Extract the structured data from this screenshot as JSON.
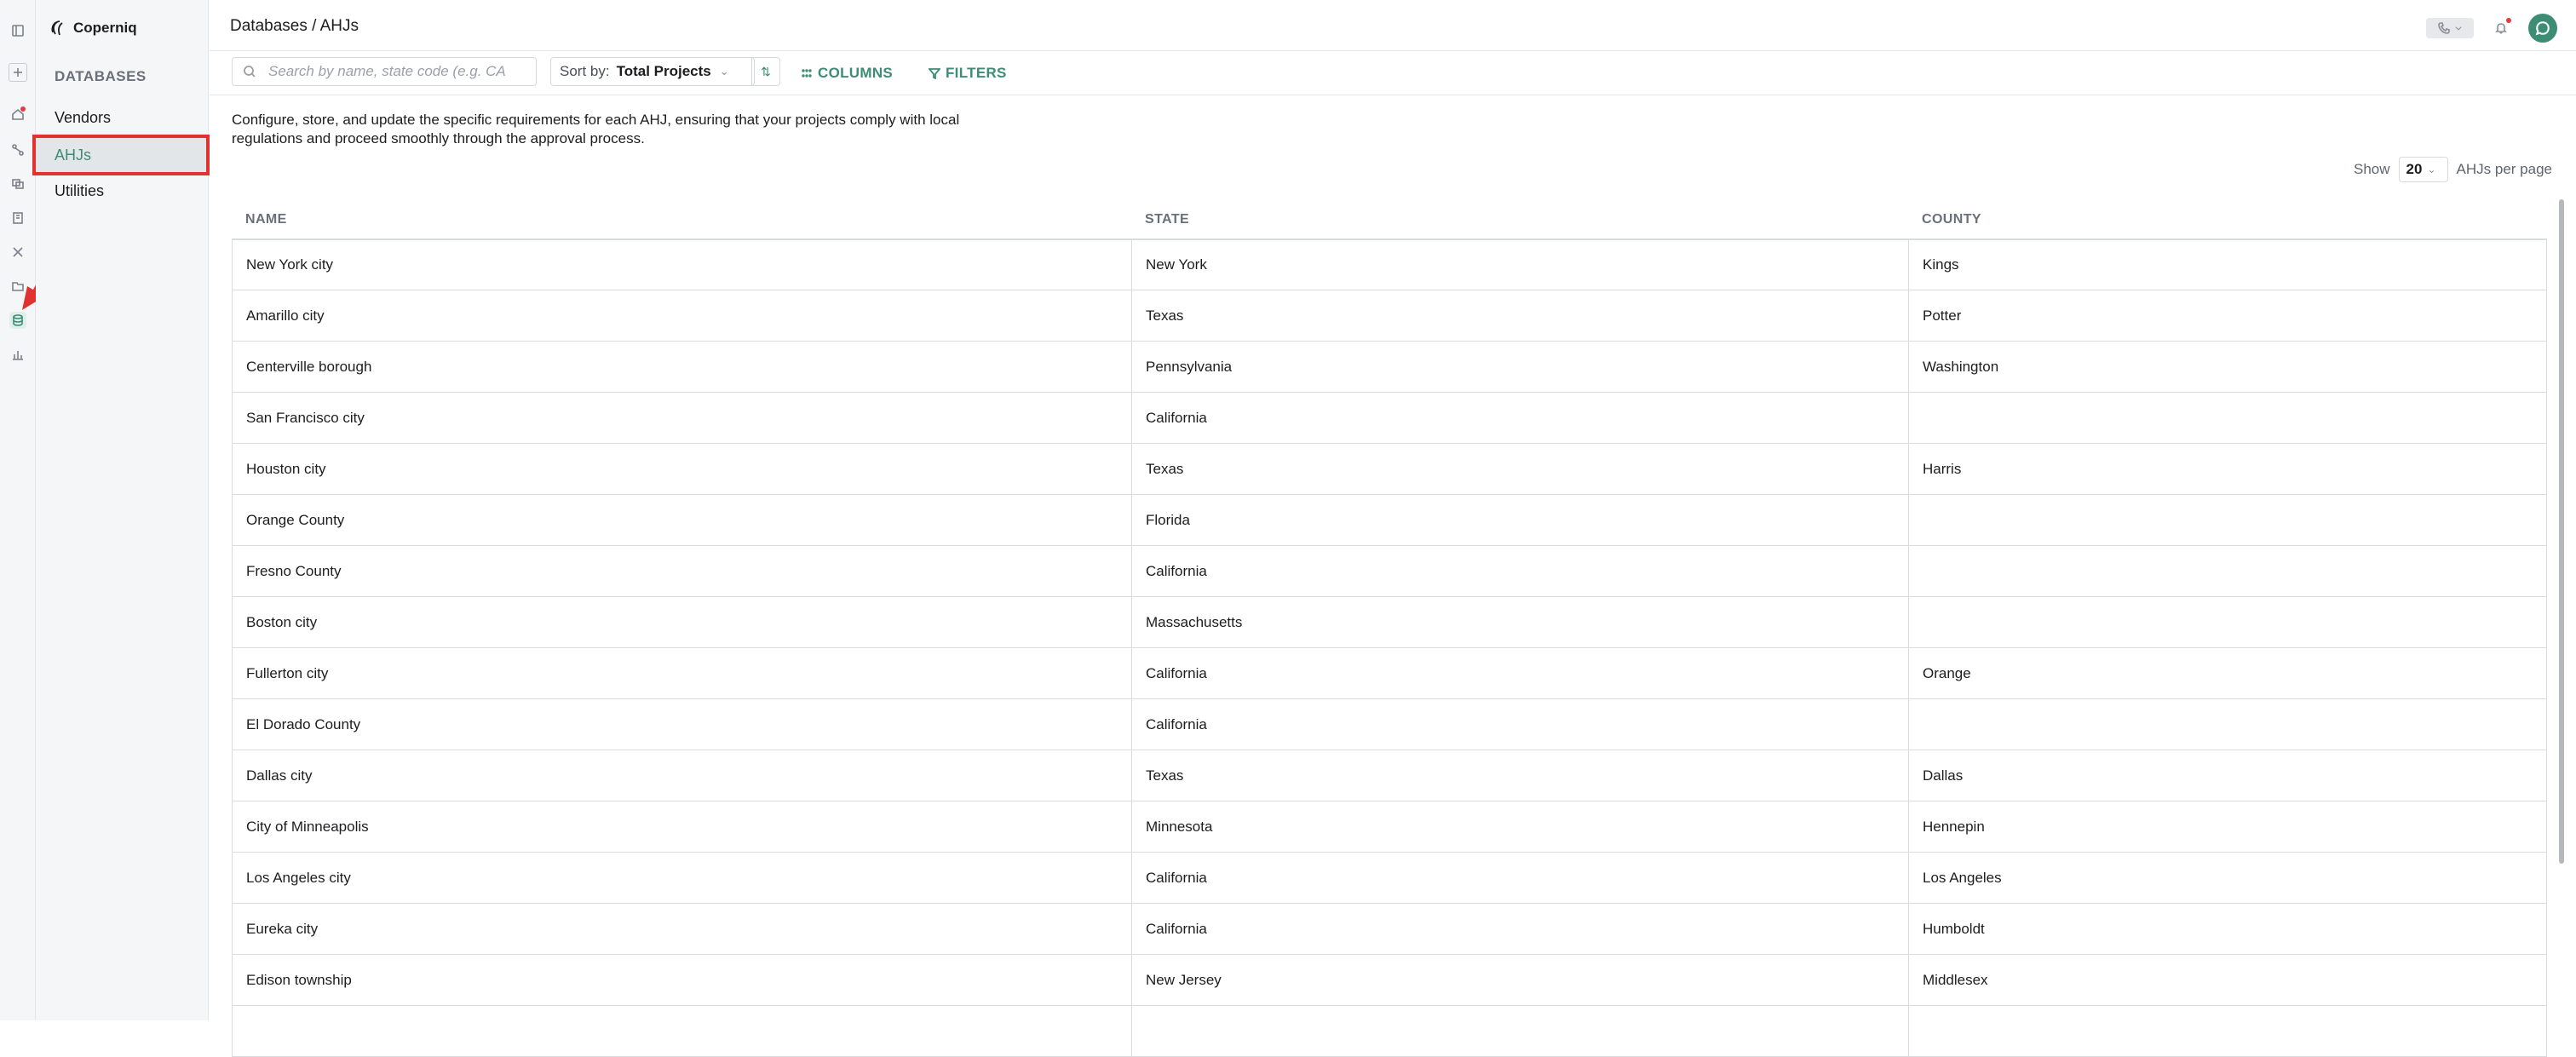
{
  "app": {
    "name": "Coperniq"
  },
  "sidebar": {
    "heading": "DATABASES",
    "items": [
      {
        "label": "Vendors"
      },
      {
        "label": "AHJs"
      },
      {
        "label": "Utilities"
      }
    ]
  },
  "header": {
    "breadcrumb": "Databases / AHJs"
  },
  "toolbar": {
    "search_placeholder": "Search by name, state code (e.g. CA",
    "sort_label": "Sort by:",
    "sort_value": "Total Projects",
    "sort_dir_glyph": "⇅",
    "columns_label": "COLUMNS",
    "filters_label": "FILTERS"
  },
  "description": "Configure, store, and update the specific requirements for each AHJ, ensuring that your projects comply with local regulations and proceed smoothly through the approval process.",
  "pagination": {
    "show_label": "Show",
    "per_page_value": "20",
    "per_page_suffix": "AHJs per page"
  },
  "table": {
    "columns": [
      "NAME",
      "STATE",
      "COUNTY"
    ],
    "rows": [
      [
        "New York city",
        "New York",
        "Kings"
      ],
      [
        "Amarillo city",
        "Texas",
        "Potter"
      ],
      [
        "Centerville borough",
        "Pennsylvania",
        "Washington"
      ],
      [
        "San Francisco city",
        "California",
        ""
      ],
      [
        "Houston city",
        "Texas",
        "Harris"
      ],
      [
        "Orange County",
        "Florida",
        ""
      ],
      [
        "Fresno County",
        "California",
        ""
      ],
      [
        "Boston city",
        "Massachusetts",
        ""
      ],
      [
        "Fullerton city",
        "California",
        "Orange"
      ],
      [
        "El Dorado County",
        "California",
        ""
      ],
      [
        "Dallas city",
        "Texas",
        "Dallas"
      ],
      [
        "City of Minneapolis",
        "Minnesota",
        "Hennepin"
      ],
      [
        "Los Angeles city",
        "California",
        "Los Angeles"
      ],
      [
        "Eureka city",
        "California",
        "Humboldt"
      ],
      [
        "Edison township",
        "New Jersey",
        "Middlesex"
      ],
      [
        "",
        "",
        ""
      ]
    ]
  },
  "colors": {
    "accent": "#3d8c74",
    "highlight": "#e0322e",
    "notification": "#e23b3b"
  }
}
